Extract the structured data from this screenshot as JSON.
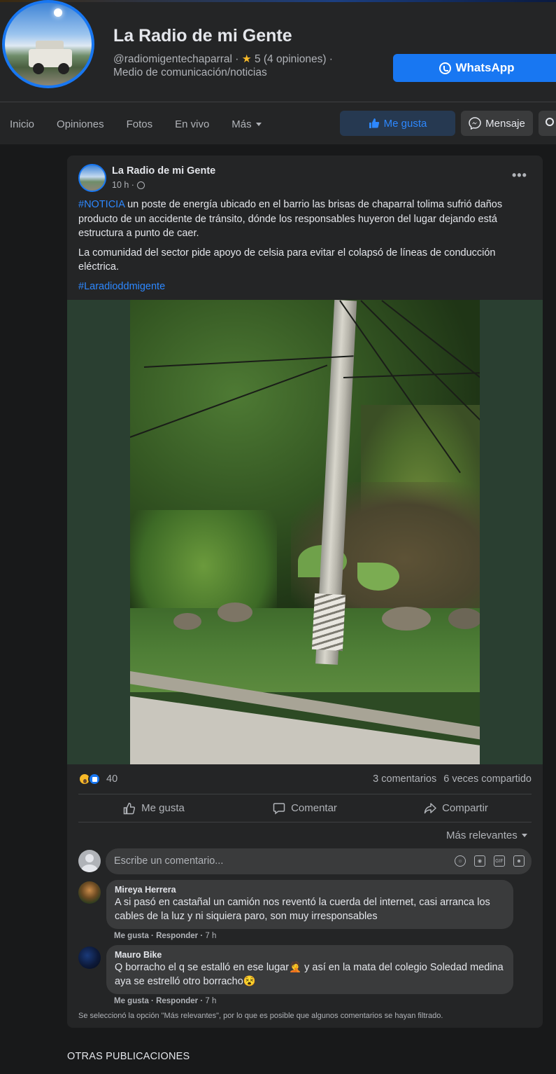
{
  "page": {
    "name": "La Radio de mi Gente",
    "handle": "@radiomigentechaparral",
    "rating_text": "5 (4 opiniones) ·",
    "category": "Medio de comunicación/noticias",
    "whatsapp_label": "WhatsApp"
  },
  "nav": {
    "items": [
      "Inicio",
      "Opiniones",
      "Fotos",
      "En vivo",
      "Más"
    ],
    "like_label": "Me gusta",
    "message_label": "Mensaje"
  },
  "post": {
    "author": "La Radio de mi Gente",
    "time": "10 h ·",
    "paragraph1_hashtag": "#NOTICIA",
    "paragraph1_text": " un poste de energía ubicado en el barrio las brisas de chaparral tolima sufrió daños producto de un accidente de tránsito, dónde los responsables huyeron del lugar dejando está estructura a punto de caer.",
    "paragraph2": "La comunidad del sector pide apoyo de celsia para evitar el colapsó de líneas de conducción eléctrica.",
    "paragraph3_hashtag": "#Laradioddmigente",
    "reactions_count": "40",
    "comments_count": "3 comentarios",
    "shares_count": "6 veces compartido",
    "actions": {
      "like": "Me gusta",
      "comment": "Comentar",
      "share": "Compartir"
    },
    "sort_label": "Más relevantes",
    "comment_placeholder": "Escribe un comentario...",
    "comment_tools": [
      "emoji-icon",
      "camera-icon",
      "gif-icon",
      "sticker-icon"
    ]
  },
  "comments": [
    {
      "name": "Mireya Herrera",
      "text": "A si pasó en castañal un camión nos reventó la cuerda del internet, casi arranca los cables de la luz y ni siquiera paro, son muy irresponsables",
      "like": "Me gusta",
      "reply": "Responder",
      "time": "7 h"
    },
    {
      "name": "Mauro Bike",
      "text": "Q borracho el q se estalló en ese lugar🤦 y así en la mata del colegio Soledad medina aya se estrelló otro borracho😵",
      "like": "Me gusta",
      "reply": "Responder",
      "time": "7 h"
    }
  ],
  "filter_note": "Se seleccionó la opción \"Más relevantes\", por lo que es posible que algunos comentarios se hayan filtrado.",
  "other_posts_heading": "OTRAS PUBLICACIONES",
  "colors": {
    "accent": "#1877f2",
    "link": "#2d88ff",
    "background": "#18191a",
    "surface": "#242526",
    "bubble": "#3a3b3c"
  }
}
